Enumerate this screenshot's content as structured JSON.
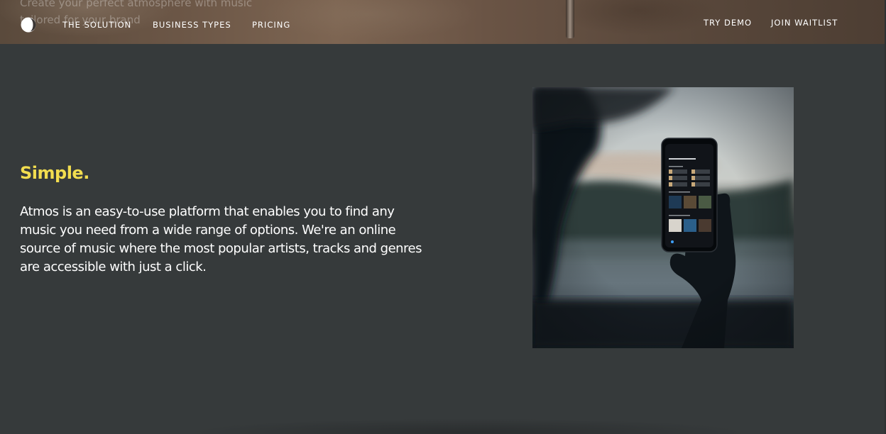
{
  "header": {
    "hero_text_line1": "Create your perfect atmosphere with music",
    "hero_text_line2": "tailored for your brand",
    "logo_icon": "atmos-logo-icon",
    "nav_left": [
      {
        "label": "THE SOLUTION"
      },
      {
        "label": "BUSINESS TYPES"
      },
      {
        "label": "PRICING"
      }
    ],
    "nav_right": [
      {
        "label": "TRY DEMO"
      },
      {
        "label": "JOIN WAITLIST"
      }
    ]
  },
  "section": {
    "title": "Simple.",
    "body": "Atmos is an easy-to-use platform that enables you to find any music you need from a wide range of options. We're an online source of music where the most popular artists, tracks and genres are accessible with just a click."
  },
  "phone_screen": {
    "heading": "Good afternoon",
    "subheading1": "Jump back in",
    "subheading2": "Playlists made for you",
    "subheading3": "Popular playlists"
  },
  "colors": {
    "background": "#363a3b",
    "accent_yellow": "#f2dd4f",
    "text": "#ffffff"
  }
}
